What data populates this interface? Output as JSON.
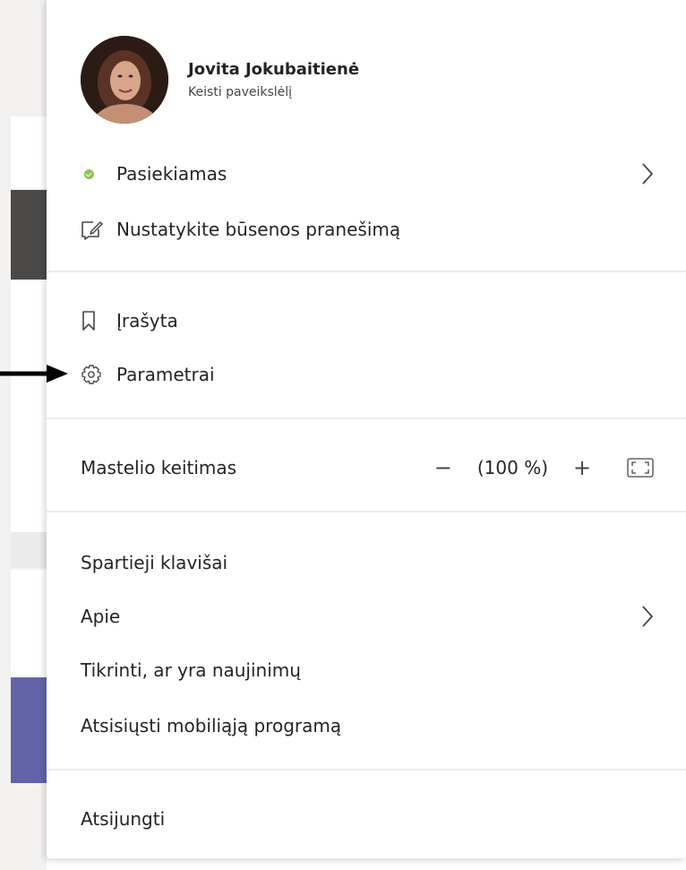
{
  "profile": {
    "name": "Jovita Jokubaitienė",
    "change_picture": "Keisti paveikslėlį"
  },
  "status": {
    "label": "Pasiekiamas",
    "color": "#92c353"
  },
  "status_message": {
    "label": "Nustatykite būsenos pranešimą"
  },
  "saved": {
    "label": "Įrašyta"
  },
  "settings": {
    "label": "Parametrai"
  },
  "zoom": {
    "label": "Mastelio keitimas",
    "minus": "−",
    "value": "(100 %)",
    "plus": "+"
  },
  "menu_items": {
    "shortcuts": "Spartieji klavišai",
    "about": "Apie",
    "check_updates": "Tikrinti, ar yra naujinimų",
    "download_mobile": "Atsisiųsti mobiliąją programą",
    "sign_out": "Atsijungti"
  },
  "colors": {
    "accent_purple": "#6264a7",
    "divider": "#edebe9"
  }
}
